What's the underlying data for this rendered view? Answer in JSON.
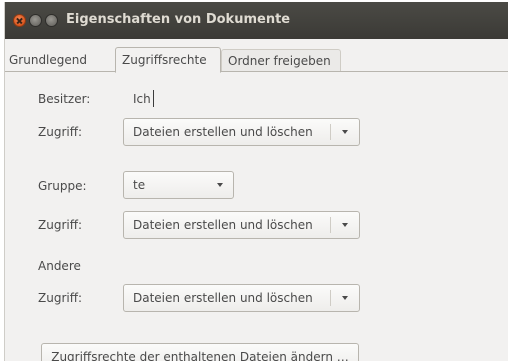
{
  "window": {
    "title": "Eigenschaften von Dokumente"
  },
  "tabs": [
    {
      "label": "Grundlegend",
      "active": false
    },
    {
      "label": "Zugriffsrechte",
      "active": true
    },
    {
      "label": "Ordner freigeben",
      "active": false
    }
  ],
  "owner": {
    "label": "Besitzer:",
    "value": "Ich",
    "access_label": "Zugriff:",
    "access_value": "Dateien erstellen und löschen"
  },
  "group": {
    "label": "Gruppe:",
    "value": "te",
    "access_label": "Zugriff:",
    "access_value": "Dateien erstellen und löschen"
  },
  "others": {
    "label": "Andere",
    "access_label": "Zugriff:",
    "access_value": "Dateien erstellen und löschen"
  },
  "apply_button": {
    "label": "Zugriffsrechte der enthaltenen Dateien ändern …"
  },
  "icons": {
    "close": "close-icon",
    "minimize": "minimize-icon",
    "maximize": "maximize-icon",
    "dropdown": "chevron-down-icon"
  },
  "colors": {
    "titlebar": "#3c3b37",
    "close_button": "#e95420",
    "window_bg": "#f2f1f0"
  }
}
